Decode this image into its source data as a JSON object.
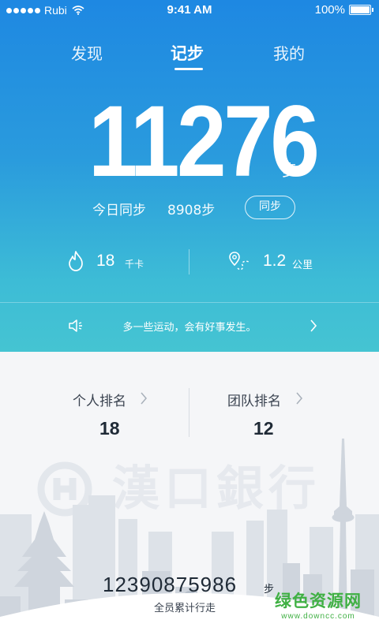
{
  "status_bar": {
    "carrier": "Rubi",
    "time": "9:41 AM",
    "battery": "100%"
  },
  "tabs": [
    {
      "label": "发现"
    },
    {
      "label": "记步",
      "active": true
    },
    {
      "label": "我的"
    }
  ],
  "today": {
    "steps": "11276",
    "steps_unit": "步",
    "sync_label": "今日同步",
    "sync_value": "8908步",
    "sync_button": "同步"
  },
  "stats": {
    "calories_value": "18",
    "calories_unit": "千卡",
    "distance_value": "1.2",
    "distance_unit": "公里"
  },
  "notice": {
    "text": "多一些运动，会有好事发生。"
  },
  "ranking": {
    "personal_label": "个人排名",
    "personal_value": "18",
    "team_label": "团队排名",
    "team_value": "12"
  },
  "banner": {
    "watermark_text": "漢口銀行"
  },
  "total": {
    "value": "12390875986",
    "unit": "步",
    "caption": "全员累计行走"
  },
  "site_watermark": {
    "title": "绿色资源网",
    "url": "www.downcc.com"
  },
  "colors": {
    "hero_top": "#1e88e2",
    "hero_bottom": "#45c4d2",
    "lower_bg": "#f5f6f8",
    "text_dark": "#1f2a36",
    "watermark_green": "#3fb043"
  }
}
